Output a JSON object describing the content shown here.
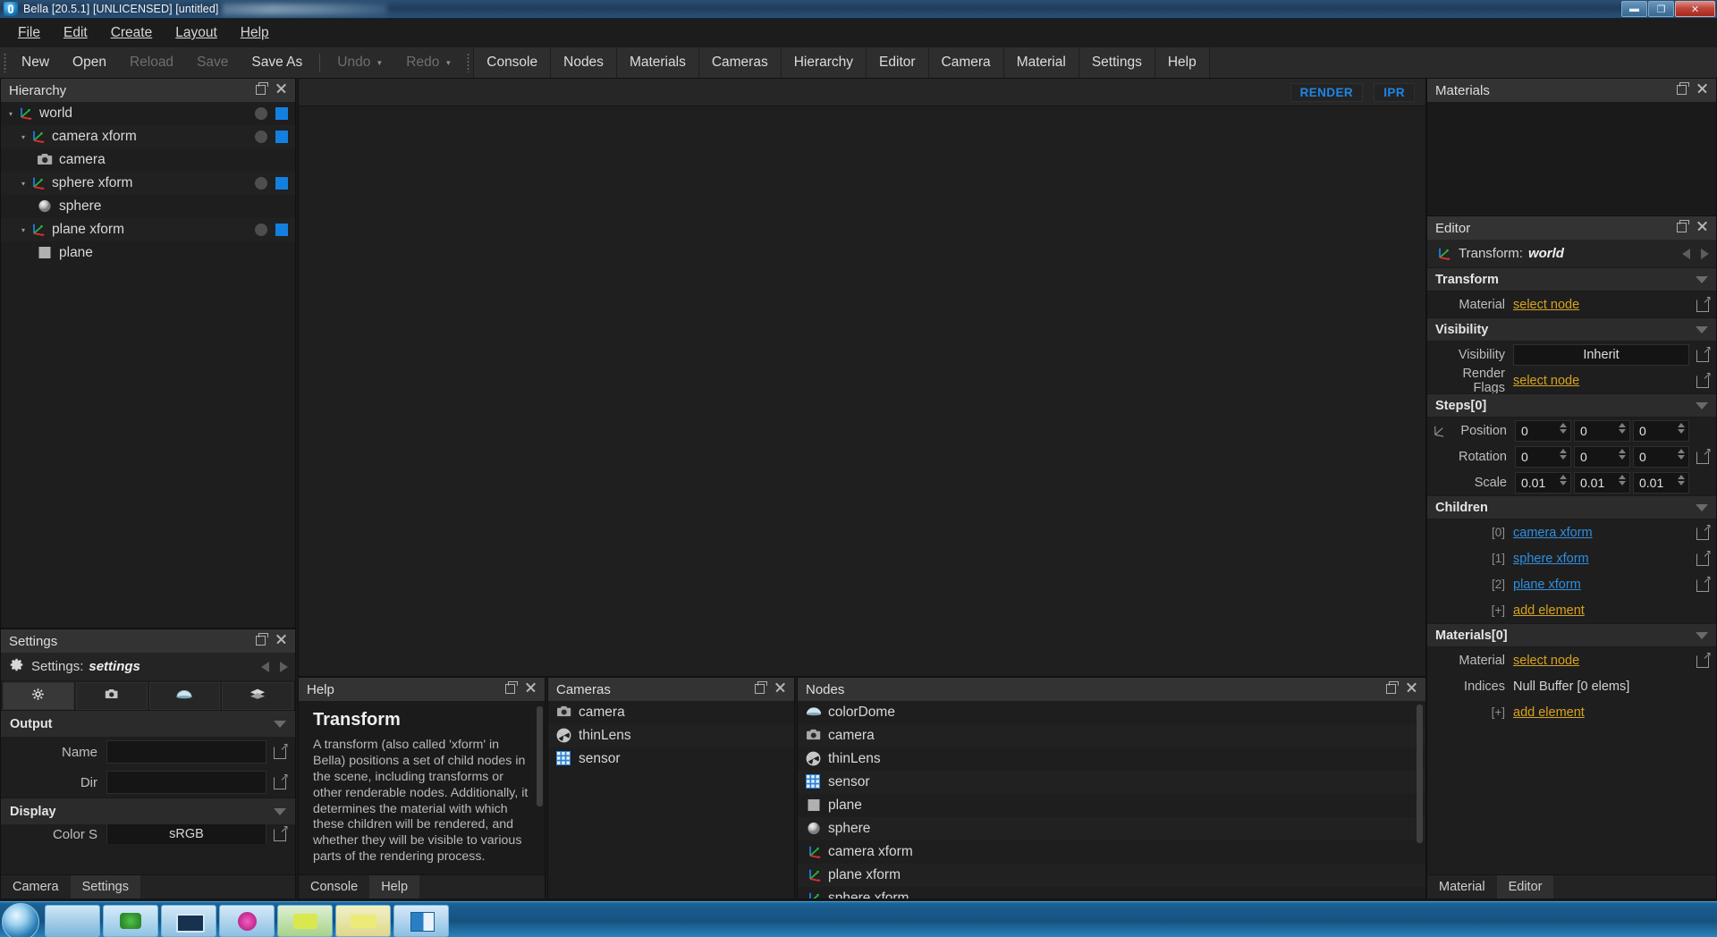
{
  "window": {
    "title": "Bella [20.5.1] [UNLICENSED] [untitled]",
    "minimize": "—",
    "maximize": "❐",
    "close": "✕"
  },
  "menubar": [
    {
      "label": "File"
    },
    {
      "label": "Edit"
    },
    {
      "label": "Create"
    },
    {
      "label": "Layout"
    },
    {
      "label": "Help"
    }
  ],
  "toolbar": {
    "file_actions": [
      {
        "label": "New",
        "enabled": true
      },
      {
        "label": "Open",
        "enabled": true
      },
      {
        "label": "Reload",
        "enabled": false
      },
      {
        "label": "Save",
        "enabled": false
      },
      {
        "label": "Save As",
        "enabled": true
      }
    ],
    "history": [
      {
        "label": "Undo",
        "enabled": false
      },
      {
        "label": "Redo",
        "enabled": false
      }
    ],
    "panel_tabs": [
      "Console",
      "Nodes",
      "Materials",
      "Cameras",
      "Hierarchy",
      "Editor",
      "Camera",
      "Material",
      "Settings",
      "Help"
    ]
  },
  "hierarchy": {
    "title": "Hierarchy",
    "rows": [
      {
        "label": "world",
        "icon": "axis-gizmo-icon",
        "depth": 0,
        "twisty": "▾",
        "has_indicators": true
      },
      {
        "label": "camera xform",
        "icon": "axis-gizmo-icon",
        "depth": 1,
        "twisty": "▾",
        "has_indicators": true
      },
      {
        "label": "camera",
        "icon": "camera-icon",
        "depth": 2,
        "twisty": "",
        "has_indicators": false
      },
      {
        "label": "sphere xform",
        "icon": "axis-gizmo-icon",
        "depth": 1,
        "twisty": "▾",
        "has_indicators": true
      },
      {
        "label": "sphere",
        "icon": "sphere-icon",
        "depth": 2,
        "twisty": "",
        "has_indicators": false
      },
      {
        "label": "plane xform",
        "icon": "axis-gizmo-icon",
        "depth": 1,
        "twisty": "▾",
        "has_indicators": true
      },
      {
        "label": "plane",
        "icon": "plane-icon",
        "depth": 2,
        "twisty": "",
        "has_indicators": false
      }
    ]
  },
  "viewport": {
    "render_button": "RENDER",
    "ipr_button": "IPR"
  },
  "settings_panel": {
    "title": "Settings",
    "node_label": "Settings:",
    "node_name": "settings",
    "segment_tabs": [
      {
        "icon": "gear-icon",
        "active": true
      },
      {
        "icon": "camera-icon",
        "active": false
      },
      {
        "icon": "dome-icon",
        "active": false
      },
      {
        "icon": "layers-icon",
        "active": false
      }
    ],
    "sections": [
      {
        "title": "Output",
        "rows": [
          {
            "label": "Name",
            "value": ""
          },
          {
            "label": "Dir",
            "value": ""
          }
        ]
      },
      {
        "title": "Display",
        "rows": [
          {
            "label": "Color S",
            "value": "sRGB"
          }
        ]
      }
    ],
    "bottom_tabs": [
      {
        "label": "Camera",
        "active": false
      },
      {
        "label": "Settings",
        "active": true
      }
    ]
  },
  "help_panel": {
    "title": "Help",
    "doc_title": "Transform",
    "doc_text": "A transform (also called 'xform' in Bella) positions a set of child nodes in the scene, including transforms or other renderable nodes. Additionally, it determines the material with which these children will be rendered, and whether they will be visible to various parts of the rendering process.",
    "bottom_tabs": [
      {
        "label": "Console",
        "active": false
      },
      {
        "label": "Help",
        "active": true
      }
    ]
  },
  "cameras_panel": {
    "title": "Cameras",
    "items": [
      {
        "label": "camera",
        "icon": "camera-icon"
      },
      {
        "label": "thinLens",
        "icon": "aperture-icon"
      },
      {
        "label": "sensor",
        "icon": "sensor-grid-icon"
      }
    ]
  },
  "nodes_panel": {
    "title": "Nodes",
    "items": [
      {
        "label": "colorDome",
        "icon": "dome-icon"
      },
      {
        "label": "camera",
        "icon": "camera-icon"
      },
      {
        "label": "thinLens",
        "icon": "aperture-icon"
      },
      {
        "label": "sensor",
        "icon": "sensor-grid-icon"
      },
      {
        "label": "plane",
        "icon": "plane-icon"
      },
      {
        "label": "sphere",
        "icon": "sphere-icon"
      },
      {
        "label": "camera xform",
        "icon": "axis-gizmo-icon"
      },
      {
        "label": "plane xform",
        "icon": "axis-gizmo-icon"
      },
      {
        "label": "sphere xform",
        "icon": "axis-gizmo-icon"
      }
    ]
  },
  "materials_panel": {
    "title": "Materials",
    "items": []
  },
  "editor_panel": {
    "title": "Editor",
    "node_label": "Transform:",
    "node_name": "world",
    "sections": {
      "transform": {
        "title": "Transform",
        "material_label": "Material",
        "material_value": "select node"
      },
      "visibility": {
        "title": "Visibility",
        "visibility_label": "Visibility",
        "visibility_value": "Inherit",
        "render_flags_label": "Render Flags",
        "render_flags_value": "select node"
      },
      "steps": {
        "title": "Steps[0]",
        "position_label": "Position",
        "position": [
          "0",
          "0",
          "0"
        ],
        "rotation_label": "Rotation",
        "rotation": [
          "0",
          "0",
          "0"
        ],
        "scale_label": "Scale",
        "scale": [
          "0.01",
          "0.01",
          "0.01"
        ]
      },
      "children": {
        "title": "Children",
        "items": [
          {
            "index": "[0]",
            "label": "camera xform"
          },
          {
            "index": "[1]",
            "label": "sphere xform"
          },
          {
            "index": "[2]",
            "label": "plane xform"
          }
        ],
        "add_index": "[+]",
        "add_label": "add element"
      },
      "materials": {
        "title": "Materials[0]",
        "material_label": "Material",
        "material_value": "select node",
        "indices_label": "Indices",
        "indices_value": "Null Buffer [0 elems]",
        "add_index": "[+]",
        "add_label": "add element"
      }
    },
    "bottom_tabs": [
      {
        "label": "Material",
        "active": false
      },
      {
        "label": "Editor",
        "active": true
      }
    ]
  },
  "colors": {
    "accent_blue": "#1380e0",
    "link_gold": "#d8a21e",
    "link_blue": "#2f8fe0",
    "render_blue": "#1f86e8",
    "panel_bg": "#1e1e1e",
    "header_bg": "#333333",
    "taskbar_blue": "#16527f"
  }
}
